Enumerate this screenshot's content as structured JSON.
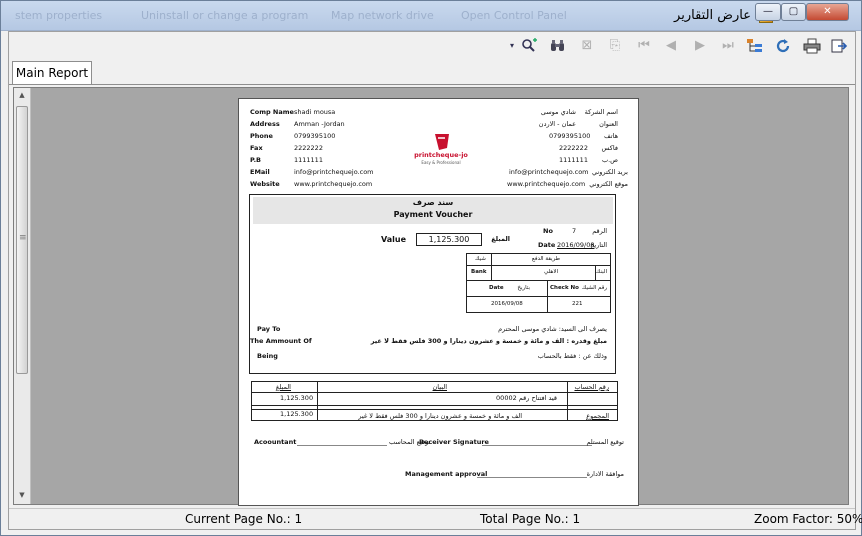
{
  "window": {
    "title": "عارض التقارير",
    "background_tabs": [
      "stem properties",
      "Uninstall or change a program",
      "Map network drive",
      "Open Control Panel"
    ],
    "controls": {
      "minimize": "—",
      "maximize": "▢",
      "close": "✕"
    }
  },
  "toolbar": {
    "icons": [
      "dropdown-arrow",
      "find-icon",
      "binoculars-icon",
      "close-doc-icon",
      "export-icon",
      "first-page-icon",
      "previous-page-icon",
      "next-page-icon",
      "last-page-icon",
      "group-tree-icon",
      "refresh-icon",
      "print-icon",
      "export-report-icon"
    ]
  },
  "tabs": [
    {
      "label": "Main Report"
    }
  ],
  "report": {
    "company": {
      "labels": {
        "name": "Comp Name",
        "address": "Address",
        "phone": "Phone",
        "fax": "Fax",
        "pb": "P.B",
        "email": "EMail",
        "website": "Website"
      },
      "values": {
        "name": "shadi mousa",
        "address": "Amman -Jordan",
        "phone": "0799395100",
        "fax": "2222222",
        "pb": "1111111",
        "email": "info@printchequejo.com",
        "website": "www.printchequejo.com"
      },
      "ar_labels": {
        "name": "اسم الشركة",
        "address": "العنوان",
        "phone": "هاتف",
        "fax": "فاكس",
        "pb": "ص.ب",
        "email": "بريد الكتروني",
        "website": "موقع الكتروني"
      },
      "ar_values": {
        "name": "شادي موسى",
        "address": "عمان - الاردن",
        "phone": "0799395100",
        "fax": "2222222",
        "pb": "1111111",
        "email": "info@printchequejo.com",
        "website": "www.printchequejo.com"
      }
    },
    "logo": {
      "brand": "printcheque-jo",
      "tagline": "Easy & Professional"
    },
    "voucher": {
      "title_ar": "سند صرف",
      "title_en": "Payment Voucher",
      "no_label": "No",
      "no_value": "7",
      "no_label_ar": "الرقم",
      "date_label": "Date",
      "date_value": "2016/09/08",
      "date_label_ar": "التاريخ",
      "value_label": "Value",
      "value_amount": "1,125.300",
      "value_label_ar": "المبلغ",
      "payment_method_ar": "طريقة الدفع",
      "cheque_ar": "شيك",
      "bank_label": "Bank",
      "bank_value": "الاهلي",
      "bank_label_ar": "البنك",
      "check_date_label": "Date",
      "check_date_label_ar": "بتاريخ",
      "check_no_label": "Check No",
      "check_no_label_ar": "رقم الشيك",
      "check_date_value": "2016/09/08",
      "check_no_value": "221",
      "pay_to_label": "Pay To",
      "pay_to_ar": "يصرف الى السيد: شادي موسى المحترم",
      "amount_label": "The Ammount Of",
      "amount_ar": "مبلغ وقدره : الف و مائة و خمسة و عشرون دينارا و 300 فلس فقط لا غير",
      "being_label": "Being",
      "being_ar": "وذلك عن : فقط بالحساب"
    },
    "table": {
      "headers": {
        "amount": "المبلغ",
        "desc": "البيان",
        "account": "رقم الحساب"
      },
      "row_amount": "1,125.300",
      "row_desc": "قيد افتتاح رقم 00002",
      "total_amount": "1,125.300",
      "total_words": "الف و مائة و خمسة و عشرون دينارا و 300 فلس فقط لا غير",
      "total_label": "المجموع"
    },
    "signatures": {
      "accountant": "Acoountant",
      "accountant_ar": "توقيع المحاسب",
      "receiver": "Receiver Signature",
      "receiver_ar": "توقيع المستلم",
      "management": "Management approval",
      "management_ar": "موافقة الادارة"
    }
  },
  "status": {
    "current_page": "Current Page No.: 1",
    "total_page": "Total Page No.: 1",
    "zoom": "Zoom Factor: 50%"
  }
}
